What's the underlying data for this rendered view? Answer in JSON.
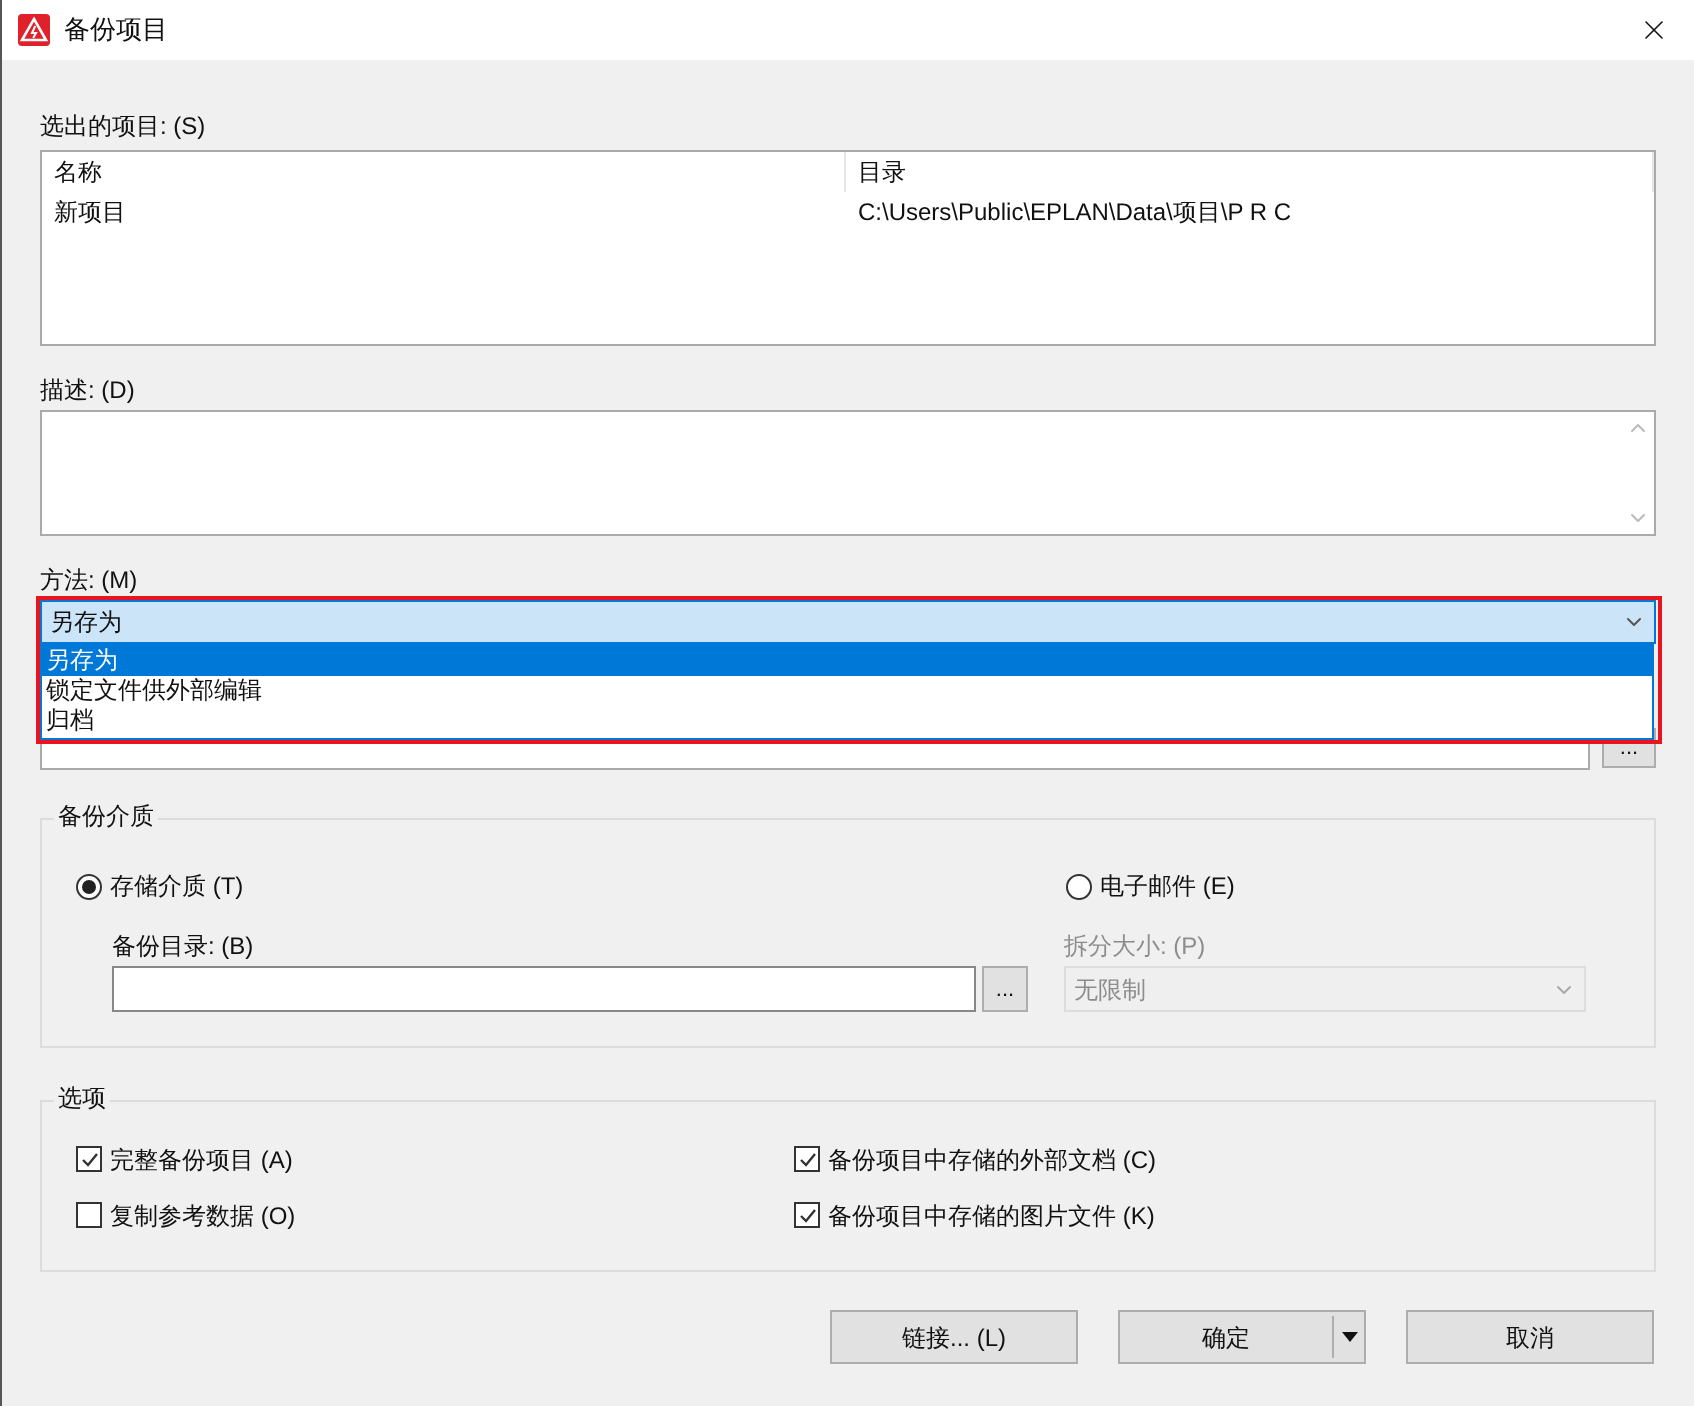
{
  "window": {
    "title": "备份项目"
  },
  "selected_projects": {
    "label": "选出的项目: (S)",
    "columns": [
      "名称",
      "目录"
    ],
    "rows": [
      [
        "新项目",
        "C:\\Users\\Public\\EPLAN\\Data\\项目\\P R C"
      ]
    ]
  },
  "description": {
    "label": "描述: (D)"
  },
  "method": {
    "label": "方法: (M)",
    "value": "另存为",
    "expanded": true,
    "highlighted": true,
    "options": [
      {
        "label": "另存为",
        "selected": true
      },
      {
        "label": "锁定文件供外部编辑",
        "selected": false
      },
      {
        "label": "归档",
        "selected": false
      }
    ]
  },
  "project_browse": "...",
  "backup_medium": {
    "title": "备份介质",
    "choices": [
      {
        "label": "存储介质 (T)",
        "selected": true
      },
      {
        "label": "电子邮件 (E)",
        "selected": false
      }
    ],
    "directory_label": "备份目录: (B)",
    "browse": "...",
    "split_label": "拆分大小: (P)",
    "split_value": "无限制",
    "split_disabled": true
  },
  "options": {
    "title": "选项",
    "items": [
      {
        "label": "完整备份项目 (A)",
        "checked": true
      },
      {
        "label": "备份项目中存储的外部文档 (C)",
        "checked": true
      },
      {
        "label": "复制参考数据 (O)",
        "checked": false
      },
      {
        "label": "备份项目中存储的图片文件 (K)",
        "checked": true
      }
    ]
  },
  "buttons": [
    {
      "label": "链接... (L)",
      "kind": "plain"
    },
    {
      "label": "确定",
      "kind": "split"
    },
    {
      "label": "取消",
      "kind": "plain"
    }
  ]
}
